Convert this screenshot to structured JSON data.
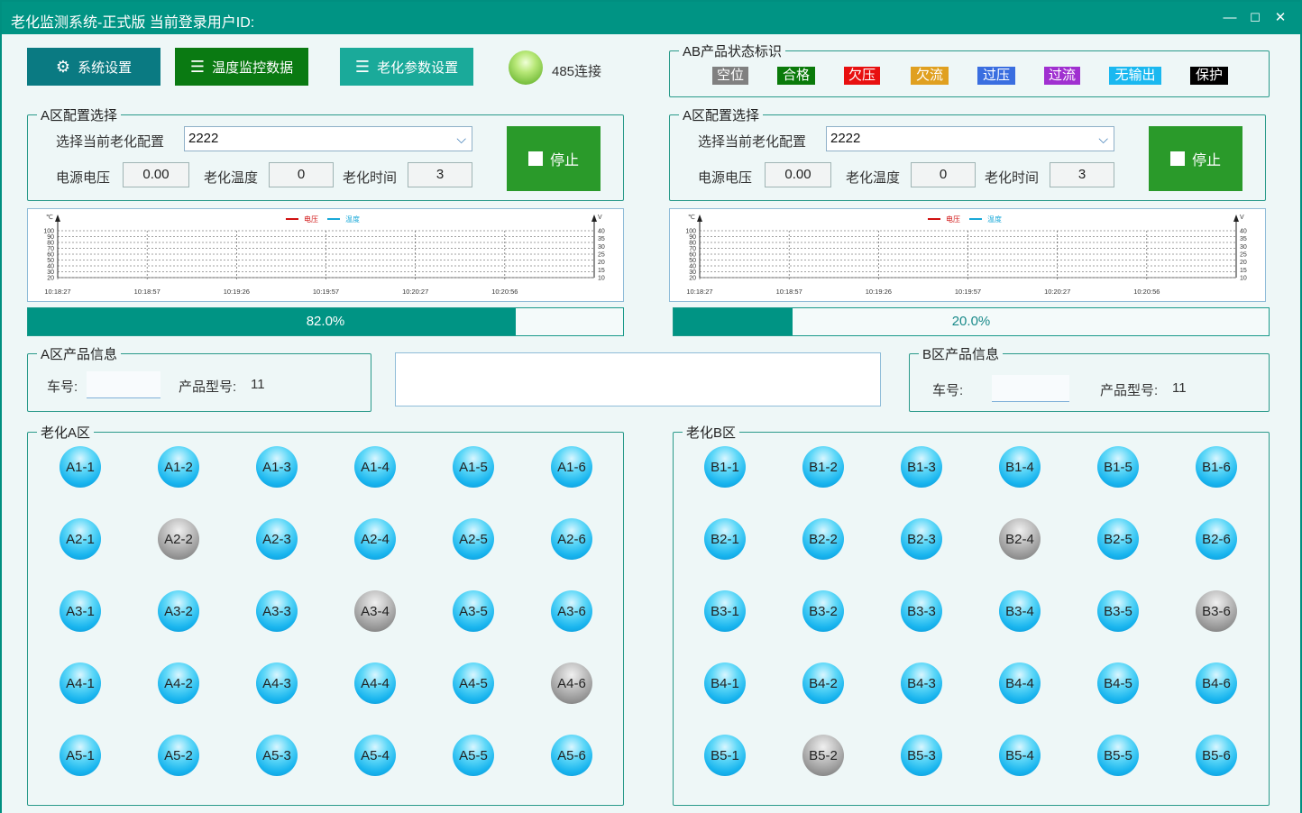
{
  "window": {
    "title": "老化监测系统-正式版 当前登录用户ID:",
    "min": "—",
    "max": "☐",
    "close": "✕"
  },
  "toolbar": {
    "settings": "系统设置",
    "temp_data": "温度监控数据",
    "aging_params": "老化参数设置",
    "conn_label": "485连接"
  },
  "status": {
    "legend": "AB产品状态标识",
    "tags": [
      {
        "label": "空位",
        "color": "#808080"
      },
      {
        "label": "合格",
        "color": "#0a7a0a"
      },
      {
        "label": "欠压",
        "color": "#e81010"
      },
      {
        "label": "欠流",
        "color": "#e0a020"
      },
      {
        "label": "过压",
        "color": "#3a6ee0"
      },
      {
        "label": "过流",
        "color": "#a030d0"
      },
      {
        "label": "无输出",
        "color": "#1ab8f0"
      },
      {
        "label": "保护",
        "color": "#000000"
      }
    ]
  },
  "configA": {
    "legend": "A区配置选择",
    "select_label": "选择当前老化配置",
    "select_value": "2222",
    "voltage_label": "电源电压",
    "voltage": "0.00",
    "temp_label": "老化温度",
    "temp": "0",
    "time_label": "老化时间",
    "time": "3",
    "stop": "停止"
  },
  "configB": {
    "legend": "A区配置选择",
    "select_label": "选择当前老化配置",
    "select_value": "2222",
    "voltage_label": "电源电压",
    "voltage": "0.00",
    "temp_label": "老化温度",
    "temp": "0",
    "time_label": "老化时间",
    "time": "3",
    "stop": "停止"
  },
  "chart_data": [
    {
      "type": "line",
      "legend": [
        "电压",
        "温度"
      ],
      "left_unit": "℃",
      "right_unit": "V",
      "y_left_ticks": [
        "100",
        "90",
        "80",
        "70",
        "60",
        "50",
        "40",
        "30",
        "20"
      ],
      "y_right_ticks": [
        "40",
        "35",
        "30",
        "25",
        "20",
        "15",
        "10"
      ],
      "x_ticks": [
        "10:18:27",
        "10:18:57",
        "10:19:26",
        "10:19:57",
        "10:20:27",
        "10:20:56"
      ],
      "series": [
        {
          "name": "电压",
          "values": []
        },
        {
          "name": "温度",
          "values": []
        }
      ],
      "colors": {
        "电压": "#d01010",
        "温度": "#18a8d8"
      },
      "grid": true
    },
    {
      "type": "line",
      "legend": [
        "电压",
        "温度"
      ],
      "left_unit": "℃",
      "right_unit": "V",
      "y_left_ticks": [
        "100",
        "90",
        "80",
        "70",
        "60",
        "50",
        "40",
        "30",
        "20"
      ],
      "y_right_ticks": [
        "40",
        "35",
        "30",
        "25",
        "20",
        "15",
        "10"
      ],
      "x_ticks": [
        "10:18:27",
        "10:18:57",
        "10:19:26",
        "10:19:57",
        "10:20:27",
        "10:20:56"
      ],
      "series": [
        {
          "name": "电压",
          "values": []
        },
        {
          "name": "温度",
          "values": []
        }
      ],
      "colors": {
        "电压": "#d01010",
        "温度": "#18a8d8"
      },
      "grid": true
    }
  ],
  "progressA": {
    "value": 0.82,
    "label": "82.0%"
  },
  "progressB": {
    "value": 0.2,
    "label": "20.0%"
  },
  "productA": {
    "legend": "A区产品信息",
    "car_label": "车号:",
    "model_label": "产品型号:",
    "model": "11"
  },
  "productB": {
    "legend": "B区产品信息",
    "car_label": "车号:",
    "model_label": "产品型号:",
    "model": "11"
  },
  "zoneA": {
    "legend": "老化A区",
    "slots": [
      [
        {
          "id": "A1-1",
          "on": true
        },
        {
          "id": "A1-2",
          "on": true
        },
        {
          "id": "A1-3",
          "on": true
        },
        {
          "id": "A1-4",
          "on": true
        },
        {
          "id": "A1-5",
          "on": true
        },
        {
          "id": "A1-6",
          "on": true
        }
      ],
      [
        {
          "id": "A2-1",
          "on": true
        },
        {
          "id": "A2-2",
          "on": false
        },
        {
          "id": "A2-3",
          "on": true
        },
        {
          "id": "A2-4",
          "on": true
        },
        {
          "id": "A2-5",
          "on": true
        },
        {
          "id": "A2-6",
          "on": true
        }
      ],
      [
        {
          "id": "A3-1",
          "on": true
        },
        {
          "id": "A3-2",
          "on": true
        },
        {
          "id": "A3-3",
          "on": true
        },
        {
          "id": "A3-4",
          "on": false
        },
        {
          "id": "A3-5",
          "on": true
        },
        {
          "id": "A3-6",
          "on": true
        }
      ],
      [
        {
          "id": "A4-1",
          "on": true
        },
        {
          "id": "A4-2",
          "on": true
        },
        {
          "id": "A4-3",
          "on": true
        },
        {
          "id": "A4-4",
          "on": true
        },
        {
          "id": "A4-5",
          "on": true
        },
        {
          "id": "A4-6",
          "on": false
        }
      ],
      [
        {
          "id": "A5-1",
          "on": true
        },
        {
          "id": "A5-2",
          "on": true
        },
        {
          "id": "A5-3",
          "on": true
        },
        {
          "id": "A5-4",
          "on": true
        },
        {
          "id": "A5-5",
          "on": true
        },
        {
          "id": "A5-6",
          "on": true
        }
      ]
    ]
  },
  "zoneB": {
    "legend": "老化B区",
    "slots": [
      [
        {
          "id": "B1-1",
          "on": true
        },
        {
          "id": "B1-2",
          "on": true
        },
        {
          "id": "B1-3",
          "on": true
        },
        {
          "id": "B1-4",
          "on": true
        },
        {
          "id": "B1-5",
          "on": true
        },
        {
          "id": "B1-6",
          "on": true
        }
      ],
      [
        {
          "id": "B2-1",
          "on": true
        },
        {
          "id": "B2-2",
          "on": true
        },
        {
          "id": "B2-3",
          "on": true
        },
        {
          "id": "B2-4",
          "on": false
        },
        {
          "id": "B2-5",
          "on": true
        },
        {
          "id": "B2-6",
          "on": true
        }
      ],
      [
        {
          "id": "B3-1",
          "on": true
        },
        {
          "id": "B3-2",
          "on": true
        },
        {
          "id": "B3-3",
          "on": true
        },
        {
          "id": "B3-4",
          "on": true
        },
        {
          "id": "B3-5",
          "on": true
        },
        {
          "id": "B3-6",
          "on": false
        }
      ],
      [
        {
          "id": "B4-1",
          "on": true
        },
        {
          "id": "B4-2",
          "on": true
        },
        {
          "id": "B4-3",
          "on": true
        },
        {
          "id": "B4-4",
          "on": true
        },
        {
          "id": "B4-5",
          "on": true
        },
        {
          "id": "B4-6",
          "on": true
        }
      ],
      [
        {
          "id": "B5-1",
          "on": true
        },
        {
          "id": "B5-2",
          "on": false
        },
        {
          "id": "B5-3",
          "on": true
        },
        {
          "id": "B5-4",
          "on": true
        },
        {
          "id": "B5-5",
          "on": true
        },
        {
          "id": "B5-6",
          "on": true
        }
      ]
    ]
  },
  "icons": {
    "settings": "gear-icon",
    "menu": "hamburger-icon",
    "connection": "status-led-icon"
  }
}
